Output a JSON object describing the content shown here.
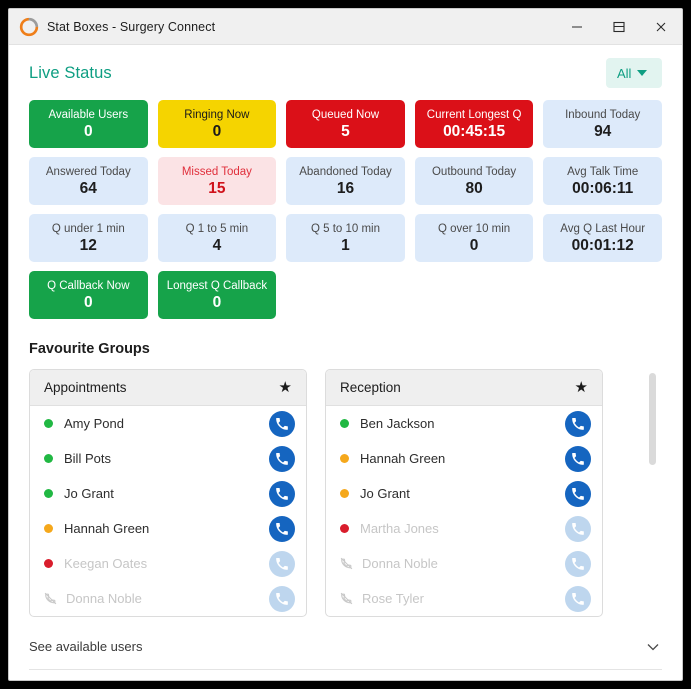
{
  "window": {
    "title": "Stat Boxes - Surgery Connect",
    "logo_icon": "surgery-connect-logo-icon",
    "controls": {
      "minimize": "—",
      "restore": "restore-icon",
      "close": "×"
    }
  },
  "accent_colors": {
    "teal": "#0e9e82",
    "green": "#16a34a",
    "yellow": "#f5d400",
    "red": "#db1018",
    "light_blue": "#ddeafa",
    "light_pink": "#fbe3e5",
    "call_blue": "#1565c0"
  },
  "live_status": {
    "title": "Live Status",
    "filter": {
      "label": "All",
      "icon": "chevron-down-icon"
    },
    "stats": [
      {
        "label": "Available Users",
        "value": "0",
        "style": "sb-green"
      },
      {
        "label": "Ringing Now",
        "value": "0",
        "style": "sb-yellow"
      },
      {
        "label": "Queued Now",
        "value": "5",
        "style": "sb-red"
      },
      {
        "label": "Current Longest Q",
        "value": "00:45:15",
        "style": "sb-red"
      },
      {
        "label": "Inbound Today",
        "value": "94",
        "style": "sb-blue"
      },
      {
        "label": "Answered Today",
        "value": "64",
        "style": "sb-blue"
      },
      {
        "label": "Missed Today",
        "value": "15",
        "style": "sb-pink"
      },
      {
        "label": "Abandoned Today",
        "value": "16",
        "style": "sb-blue"
      },
      {
        "label": "Outbound Today",
        "value": "80",
        "style": "sb-blue"
      },
      {
        "label": "Avg Talk Time",
        "value": "00:06:11",
        "style": "sb-blue"
      },
      {
        "label": "Q under 1 min",
        "value": "12",
        "style": "sb-blue"
      },
      {
        "label": "Q 1 to 5 min",
        "value": "4",
        "style": "sb-blue"
      },
      {
        "label": "Q 5 to 10 min",
        "value": "1",
        "style": "sb-blue"
      },
      {
        "label": "Q over 10 min",
        "value": "0",
        "style": "sb-blue"
      },
      {
        "label": "Avg Q Last Hour",
        "value": "00:01:12",
        "style": "sb-blue"
      },
      {
        "label": "Q Callback Now",
        "value": "0",
        "style": "sb-green"
      },
      {
        "label": "Longest Q Callback",
        "value": "0",
        "style": "sb-green"
      }
    ]
  },
  "favourite_groups": {
    "title": "Favourite Groups",
    "star_icon": "star-filled-icon",
    "call_icon": "phone-handset-icon",
    "offline_icon": "phone-off-icon",
    "groups": [
      {
        "name": "Appointments",
        "users": [
          {
            "name": "Amy Pond",
            "status": "available",
            "callable": true
          },
          {
            "name": "Bill Pots",
            "status": "available",
            "callable": true
          },
          {
            "name": "Jo Grant",
            "status": "available",
            "callable": true
          },
          {
            "name": "Hannah Green",
            "status": "busy",
            "callable": true
          },
          {
            "name": "Keegan Oates",
            "status": "dnd",
            "callable": false
          },
          {
            "name": "Donna Noble",
            "status": "offline",
            "callable": false
          }
        ]
      },
      {
        "name": "Reception",
        "users": [
          {
            "name": "Ben Jackson",
            "status": "available",
            "callable": true
          },
          {
            "name": "Hannah Green",
            "status": "busy",
            "callable": true
          },
          {
            "name": "Jo Grant",
            "status": "busy",
            "callable": true
          },
          {
            "name": "Martha Jones",
            "status": "dnd",
            "callable": false
          },
          {
            "name": "Donna Noble",
            "status": "offline",
            "callable": false
          },
          {
            "name": "Rose Tyler",
            "status": "offline",
            "callable": false
          }
        ]
      }
    ]
  },
  "footer": {
    "see_available_label": "See available users",
    "chevron_icon": "chevron-down-icon"
  }
}
